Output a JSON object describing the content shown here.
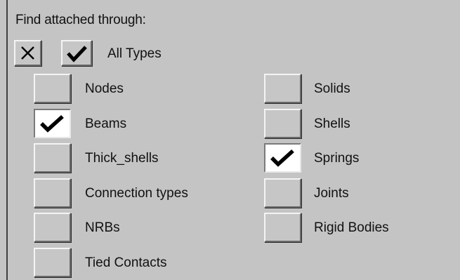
{
  "title": "Find attached through:",
  "header": {
    "clear_icon": "x-icon",
    "select_all_icon": "checkmark-icon",
    "all_types_label": "All Types"
  },
  "types_left": [
    {
      "label": "Nodes",
      "checked": false
    },
    {
      "label": "Beams",
      "checked": true
    },
    {
      "label": "Thick_shells",
      "checked": false
    },
    {
      "label": "Connection types",
      "checked": false
    },
    {
      "label": "NRBs",
      "checked": false
    },
    {
      "label": "Tied Contacts",
      "checked": false
    }
  ],
  "types_right": [
    {
      "label": "Solids",
      "checked": false
    },
    {
      "label": "Shells",
      "checked": false
    },
    {
      "label": "Springs",
      "checked": true
    },
    {
      "label": "Joints",
      "checked": false
    },
    {
      "label": "Rigid Bodies",
      "checked": false
    }
  ]
}
